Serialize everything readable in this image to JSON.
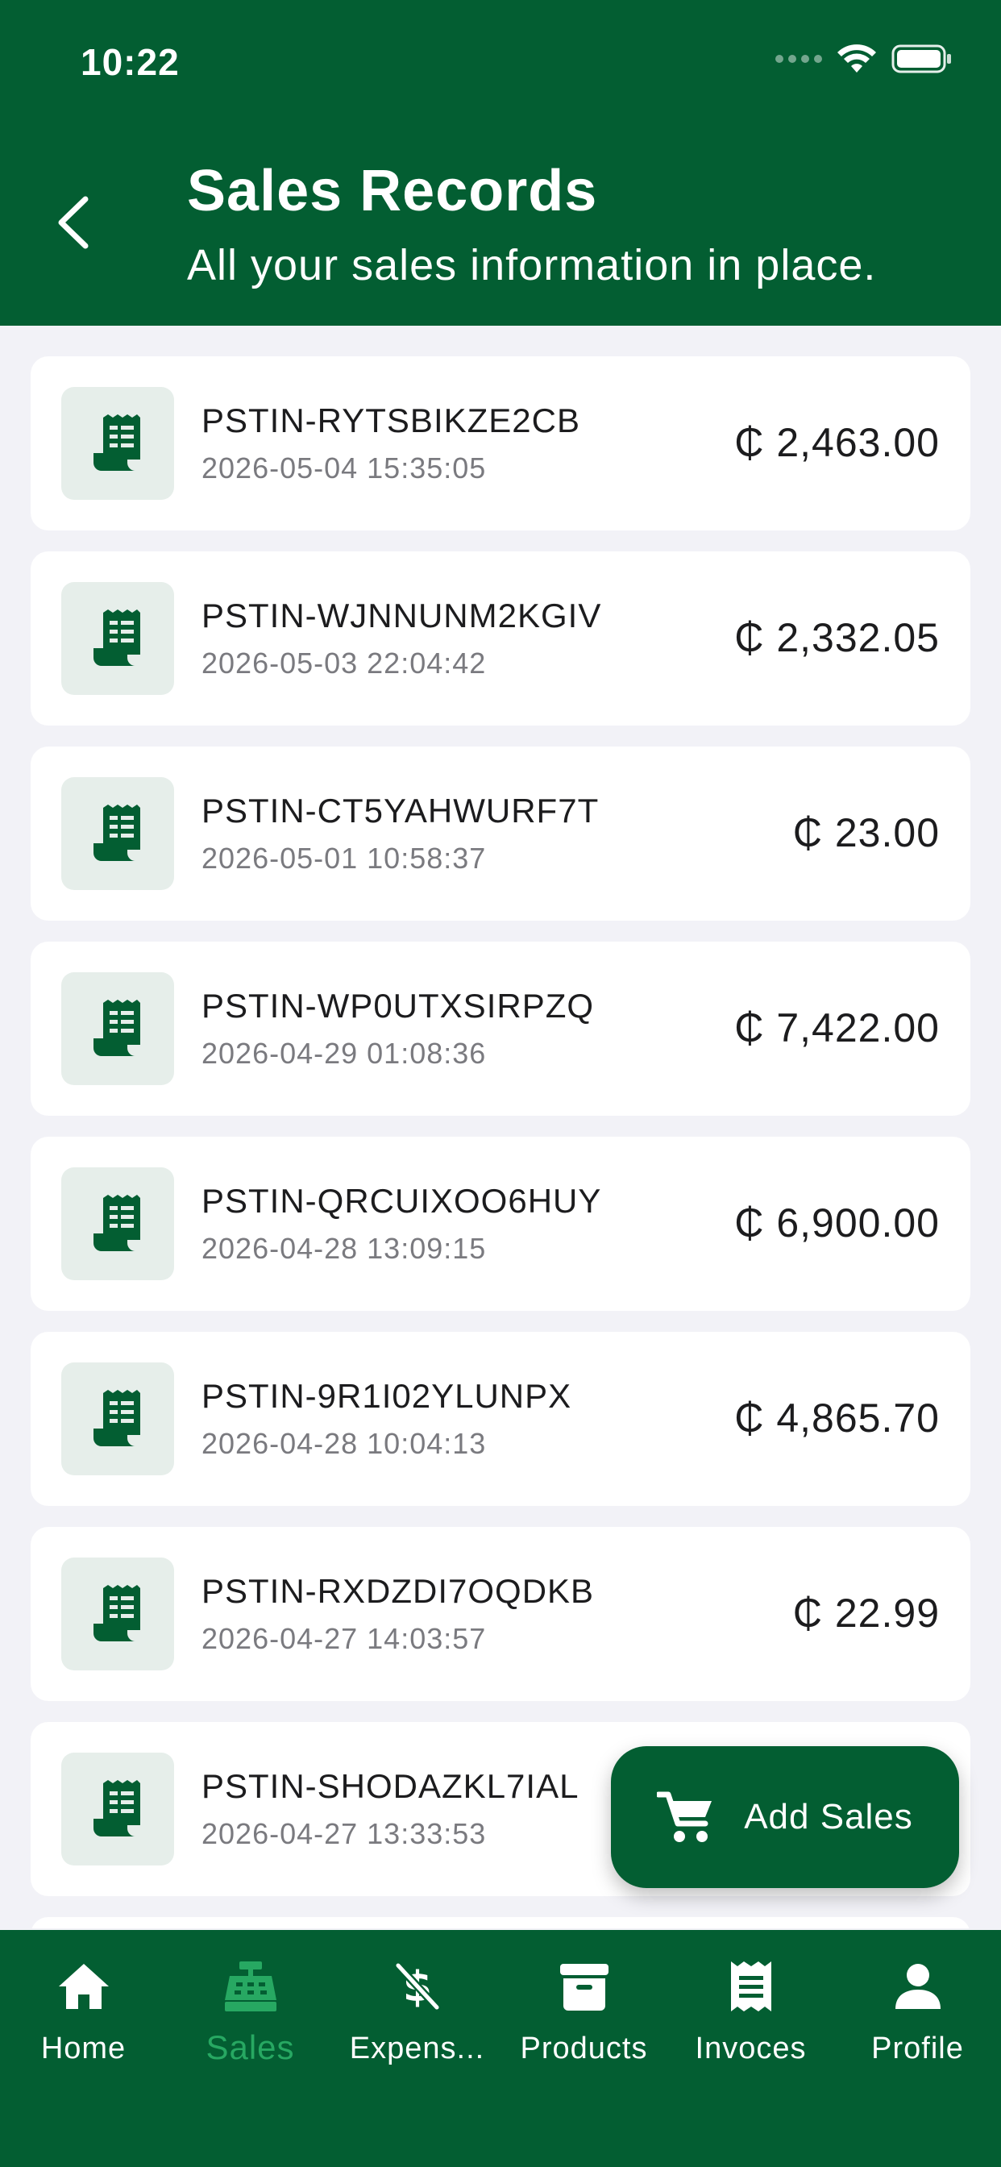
{
  "status_bar": {
    "time": "10:22"
  },
  "header": {
    "title": "Sales Records",
    "subtitle": "All your sales information in place."
  },
  "sales": [
    {
      "id": "PSTIN-RYTSBIKZE2CB",
      "date": "2026-05-04 15:35:05",
      "amount": "₵ 2,463.00"
    },
    {
      "id": "PSTIN-WJNNUNM2KGIV",
      "date": "2026-05-03 22:04:42",
      "amount": "₵ 2,332.05"
    },
    {
      "id": "PSTIN-CT5YAHWURF7T",
      "date": "2026-05-01 10:58:37",
      "amount": "₵ 23.00"
    },
    {
      "id": "PSTIN-WP0UTXSIRPZQ",
      "date": "2026-04-29 01:08:36",
      "amount": "₵ 7,422.00"
    },
    {
      "id": "PSTIN-QRCUIXOO6HUY",
      "date": "2026-04-28 13:09:15",
      "amount": "₵ 6,900.00"
    },
    {
      "id": "PSTIN-9R1I02YLUNPX",
      "date": "2026-04-28 10:04:13",
      "amount": "₵ 4,865.70"
    },
    {
      "id": "PSTIN-RXDZDI7OQDKB",
      "date": "2026-04-27 14:03:57",
      "amount": "₵ 22.99"
    },
    {
      "id": "PSTIN-SHODAZKL7IAL",
      "date": "2026-04-27 13:33:53",
      "amount": ""
    }
  ],
  "fab": {
    "label": "Add Sales"
  },
  "tabs": [
    {
      "label": "Home",
      "icon": "home-icon",
      "active": false
    },
    {
      "label": "Sales",
      "icon": "cash-register-icon",
      "active": true
    },
    {
      "label": "Expens...",
      "icon": "no-money-icon",
      "active": false
    },
    {
      "label": "Products",
      "icon": "archive-box-icon",
      "active": false
    },
    {
      "label": "Invoces",
      "icon": "receipt-icon",
      "active": false
    },
    {
      "label": "Profile",
      "icon": "person-icon",
      "active": false
    }
  ],
  "colors": {
    "brand": "#035e32",
    "active_tab": "#27a862",
    "background": "#f2f2f7",
    "icon_tile": "#e6eeea"
  }
}
